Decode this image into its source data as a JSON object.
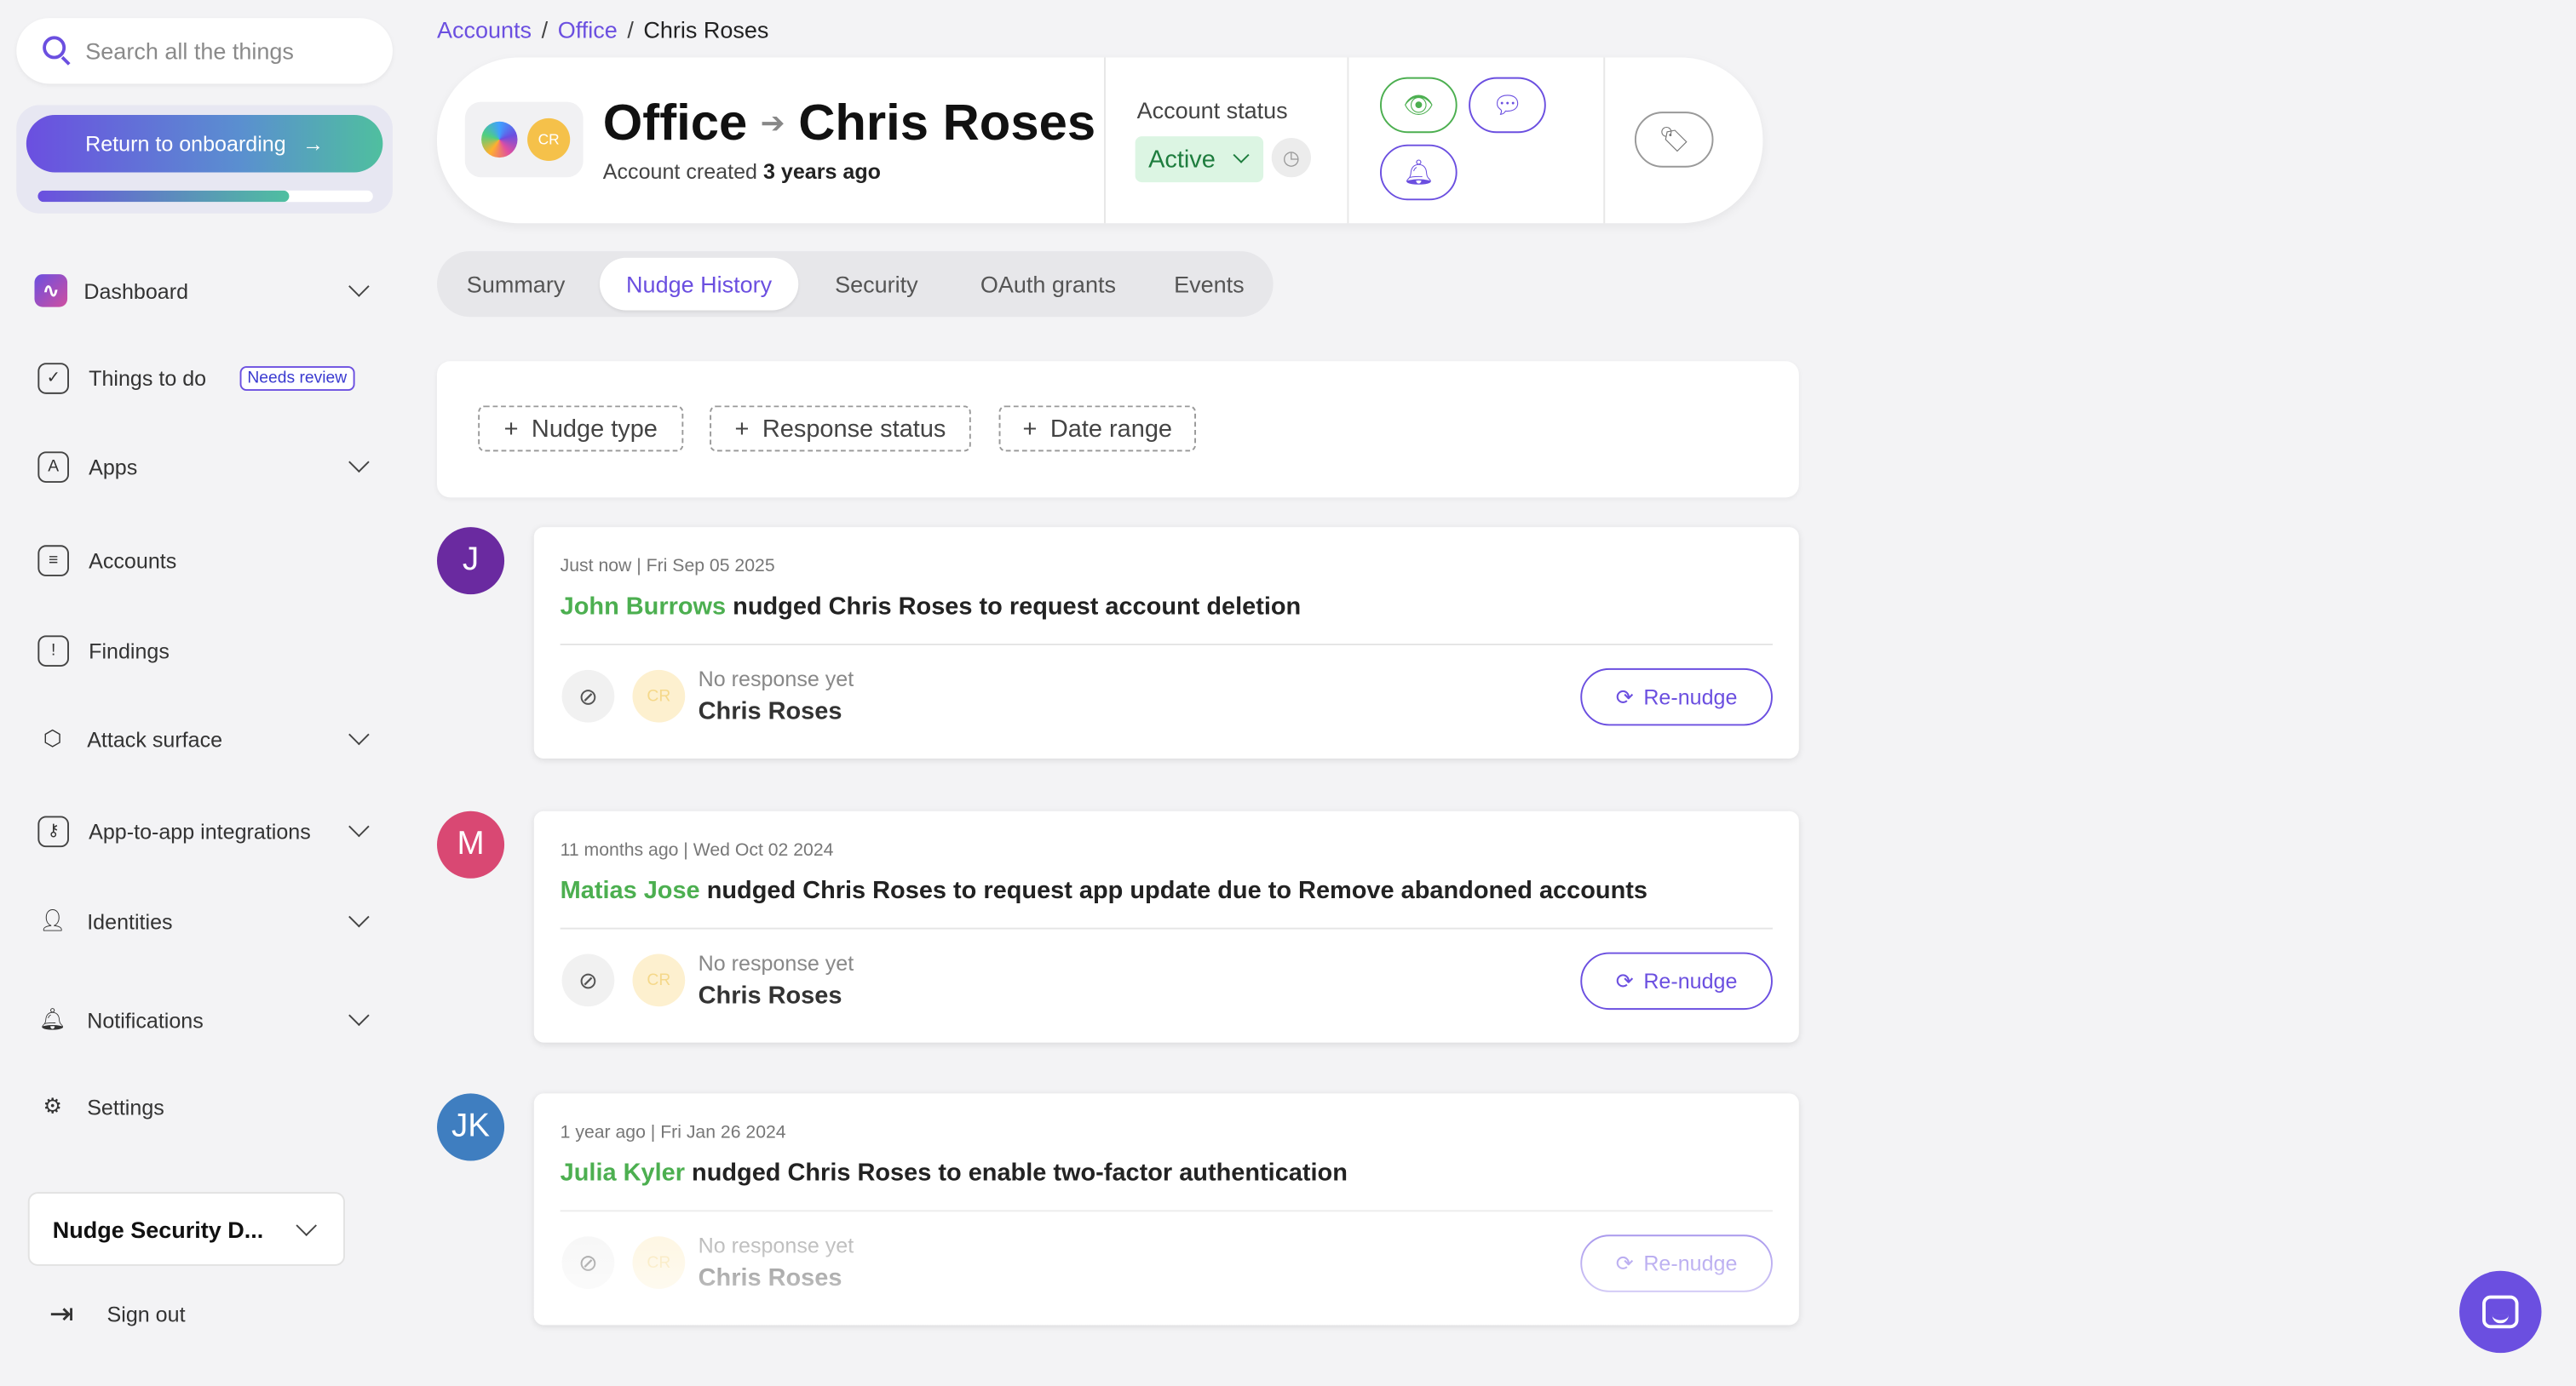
{
  "search": {
    "placeholder": "Search all the things"
  },
  "onboarding": {
    "button_label": "Return to onboarding",
    "progress": 0.75
  },
  "sidebar": {
    "items": [
      {
        "label": "Dashboard"
      },
      {
        "label": "Things to do",
        "badge": "Needs review"
      },
      {
        "label": "Apps"
      },
      {
        "label": "Accounts"
      },
      {
        "label": "Findings"
      },
      {
        "label": "Attack surface"
      },
      {
        "label": "App-to-app integrations"
      },
      {
        "label": "Identities"
      },
      {
        "label": "Notifications"
      },
      {
        "label": "Settings"
      }
    ],
    "workspace": "Nudge Security D...",
    "sign_out": "Sign out"
  },
  "breadcrumb": {
    "items": [
      "Accounts",
      "Office"
    ],
    "current": "Chris Roses"
  },
  "header": {
    "app_name": "Office",
    "account_name": "Chris Roses",
    "user_initials": "CR",
    "created_prefix": "Account created",
    "created_ago": "3 years ago",
    "status_label": "Account status",
    "status_value": "Active"
  },
  "tabs": [
    {
      "label": "Summary"
    },
    {
      "label": "Nudge History"
    },
    {
      "label": "Security"
    },
    {
      "label": "OAuth grants"
    },
    {
      "label": "Events"
    }
  ],
  "filters": [
    {
      "label": "Nudge type"
    },
    {
      "label": "Response status"
    },
    {
      "label": "Date range"
    }
  ],
  "nudges": [
    {
      "initials": "J",
      "avatar_color": "#6a2aa0",
      "date": "Just now | Fri Sep 05 2025",
      "actor": "John Burrows",
      "action": "nudged Chris Roses to request account deletion",
      "response_status": "No response yet",
      "target": "Chris Roses",
      "target_initials": "CR",
      "button": "Re-nudge"
    },
    {
      "initials": "M",
      "avatar_color": "#d94873",
      "date": "11 months ago | Wed Oct 02 2024",
      "actor": "Matias Jose",
      "action": "nudged Chris Roses to request app update due to Remove abandoned accounts",
      "response_status": "No response yet",
      "target": "Chris Roses",
      "target_initials": "CR",
      "button": "Re-nudge"
    },
    {
      "initials": "JK",
      "avatar_color": "#3f7ec0",
      "date": "1 year ago | Fri Jan 26 2024",
      "actor": "Julia Kyler",
      "action": "nudged Chris Roses to enable two-factor authentication",
      "response_status": "No response yet",
      "target": "Chris Roses",
      "target_initials": "CR",
      "button": "Re-nudge"
    }
  ],
  "colors": {
    "accent": "#6b4fe0",
    "success": "#4caf50",
    "status_bg": "#dcf5e3"
  }
}
